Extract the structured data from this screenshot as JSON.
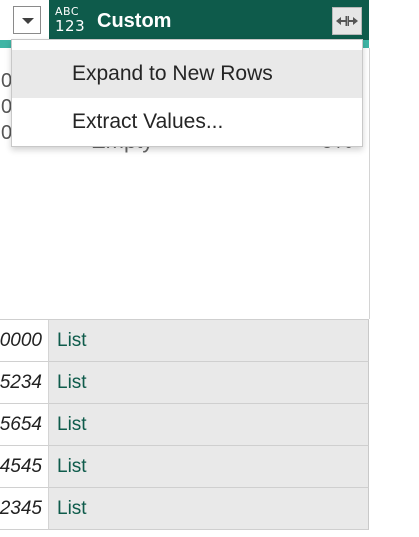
{
  "left_column": {
    "peek_values": [
      "0",
      "0",
      "0.."
    ],
    "row_values": [
      "0000",
      "5234",
      "5654",
      "4545",
      "2345"
    ]
  },
  "custom_column": {
    "type_icon": {
      "line1": "ABC",
      "line2": "123"
    },
    "title": "Custom",
    "expand_icon": "expand-arrows-icon",
    "profile_peek": {
      "empty_label": "Empty",
      "percent": "0%"
    },
    "row_values": [
      "List",
      "List",
      "List",
      "List",
      "List"
    ]
  },
  "context_menu": {
    "items": [
      {
        "label": "Expand to New Rows",
        "highlighted": true
      },
      {
        "label": "Extract Values...",
        "highlighted": false
      }
    ]
  },
  "colors": {
    "header_bg": "#0e5b4b",
    "quality_bar": "#3fb5a5",
    "list_text": "#0e5b4b"
  }
}
